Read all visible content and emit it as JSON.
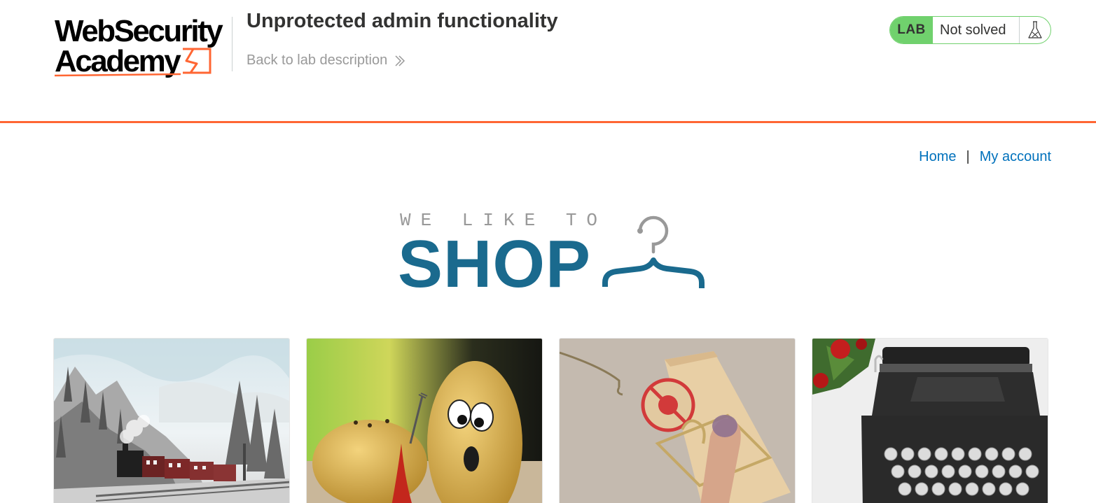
{
  "header": {
    "logo": {
      "line1": "WebSecurity",
      "line2": "Academy"
    },
    "lab_title": "Unprotected admin functionality",
    "back_link": "Back to lab description",
    "lab_status": {
      "badge": "LAB",
      "status": "Not solved",
      "icon": "flask-icon"
    }
  },
  "nav": {
    "links": [
      "Home",
      "My account"
    ],
    "separator": "|"
  },
  "banner": {
    "tagline": "WE LIKE TO",
    "title": "SHOP",
    "icon": "coat-hanger-icon"
  },
  "products": [
    {
      "image": "steam-train-in-snowy-forest"
    },
    {
      "image": "cartoon-potatoes"
    },
    {
      "image": "mousetrap-on-finger"
    },
    {
      "image": "vintage-typewriter"
    }
  ],
  "colors": {
    "accent_orange": "#ff6633",
    "lab_green": "#70d16d",
    "link_blue": "#0071bc",
    "shop_blue": "#1a6a8e",
    "grey_text": "#999999"
  }
}
